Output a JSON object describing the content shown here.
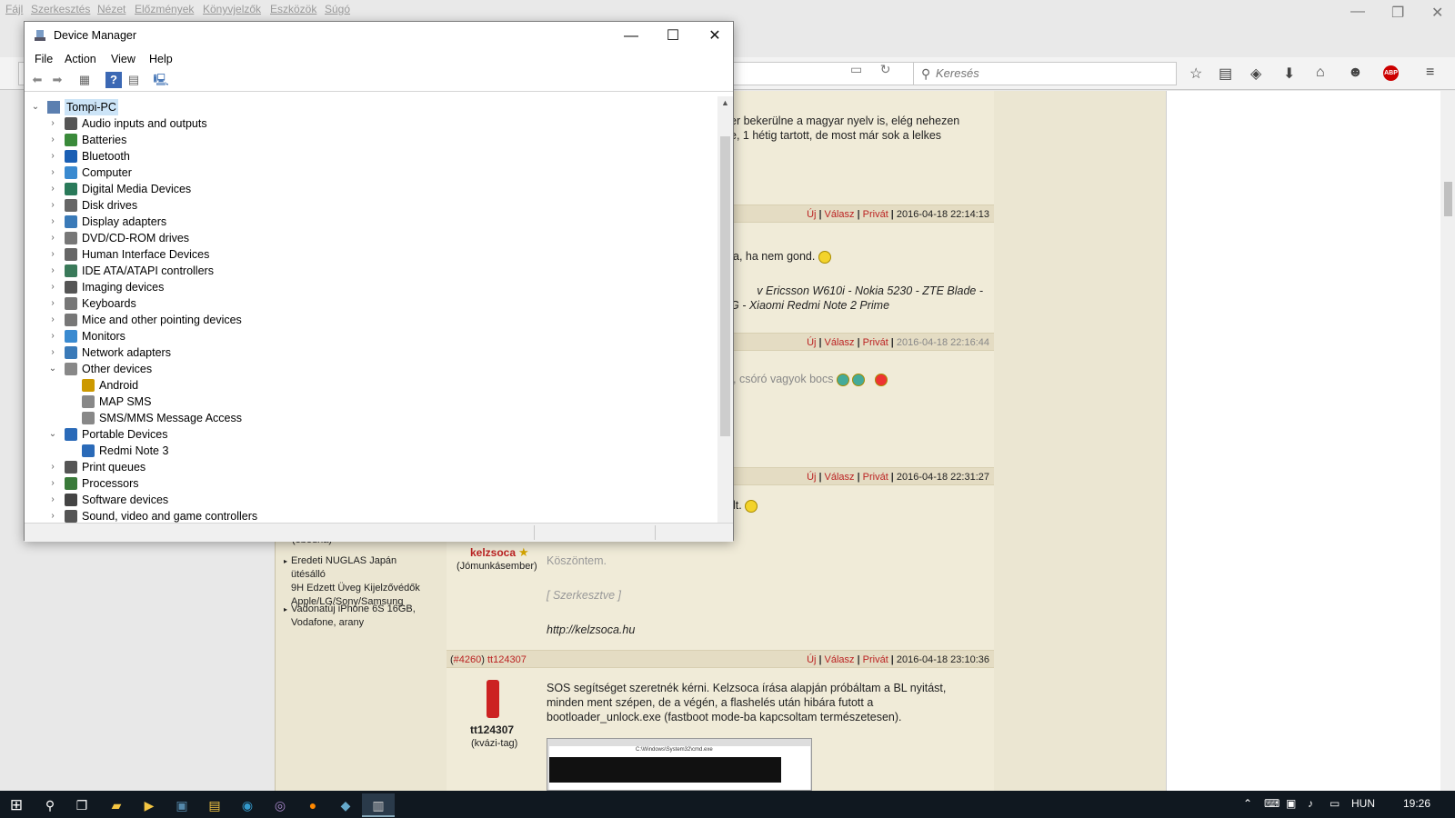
{
  "firefox": {
    "menu": [
      "Fájl",
      "Szerkesztés",
      "Nézet",
      "Előzmények",
      "Könyvjelzők",
      "Eszközök",
      "Súgó"
    ],
    "search_placeholder": "Keresés",
    "window_controls": {
      "minimize": "—",
      "restore": "❐",
      "close": "✕"
    }
  },
  "forum": {
    "post1_text_line1": "er bekerülne a magyar nyelv is, elég nehezen",
    "post1_text_line2": "e, 1 hétig tartott, de most már sok a lelkes",
    "actions": {
      "new": "Új",
      "reply": "Válasz",
      "private": "Privát"
    },
    "post2_date": "2016-04-18 22:14:13",
    "post2_text": "a, ha nem gond.",
    "post2_sig_line1": "v Ericsson W610i - Nokia 5230 - ZTE Blade -",
    "post2_sig_line2": "G - Xiaomi Redmi Note 2 Prime",
    "post3_date": "2016-04-18 22:16:44",
    "post3_text": ", csóró vagyok bocs",
    "post4_date": "2016-04-18 22:31:27",
    "post4_text": "lt.",
    "post4_user": "kelzsoca",
    "post4_rank": "(Jómunkásember)",
    "post4_body_1": "Köszöntem.",
    "post4_body_2": "[ Szerkesztve ]",
    "post4_body_3": "http://kelzsoca.hu",
    "post5_id": "#4260",
    "post5_user_link": "tt124307",
    "post5_date": "2016-04-18 23:10:36",
    "post5_user": "tt124307",
    "post5_rank": "(kvázi-tag)",
    "post5_text_1": "SOS segítséget szeretnék kérni. Kelzsoca írása alapján próbáltam a BL nyitást,",
    "post5_text_2": "minden ment szépen, de a végén, a flashelés után hibára futott a",
    "post5_text_3": "bootloader_unlock.exe (fastboot mode-ba kapcsoltam természetesen).",
    "post5_shot_title": "C:\\Windows\\System32\\cmd.exe",
    "side_partial": "(ebédna)",
    "side_item1_l1": "Eredeti NUGLAS Japán ütésálló",
    "side_item1_l2": "9H Edzett Üveg Kijelzővédők",
    "side_item1_l3": "Apple/LG/Sony/Samsung",
    "side_item2_l1": "Vadonatúj iPhone 6S 16GB,",
    "side_item2_l2": "Vodafone, arany"
  },
  "device_manager": {
    "title": "Device Manager",
    "menu": [
      "File",
      "Action",
      "View",
      "Help"
    ],
    "window_controls": {
      "minimize": "—",
      "maximize": "☐",
      "close": "✕"
    },
    "root": "Tompi-PC",
    "categories": [
      {
        "label": "Audio inputs and outputs",
        "icon": "speaker-icon",
        "color": "#555"
      },
      {
        "label": "Batteries",
        "icon": "battery-icon",
        "color": "#3a8a3a"
      },
      {
        "label": "Bluetooth",
        "icon": "bluetooth-icon",
        "color": "#1a5fb4"
      },
      {
        "label": "Computer",
        "icon": "computer-icon",
        "color": "#3a8ad0"
      },
      {
        "label": "Digital Media Devices",
        "icon": "media-icon",
        "color": "#2a7a5a"
      },
      {
        "label": "Disk drives",
        "icon": "disk-icon",
        "color": "#666"
      },
      {
        "label": "Display adapters",
        "icon": "display-adapter-icon",
        "color": "#3a7ab8"
      },
      {
        "label": "DVD/CD-ROM drives",
        "icon": "dvd-icon",
        "color": "#777"
      },
      {
        "label": "Human Interface Devices",
        "icon": "hid-icon",
        "color": "#666"
      },
      {
        "label": "IDE ATA/ATAPI controllers",
        "icon": "ide-icon",
        "color": "#3a7a5a"
      },
      {
        "label": "Imaging devices",
        "icon": "camera-icon",
        "color": "#555"
      },
      {
        "label": "Keyboards",
        "icon": "keyboard-icon",
        "color": "#777"
      },
      {
        "label": "Mice and other pointing devices",
        "icon": "mouse-icon",
        "color": "#777"
      },
      {
        "label": "Monitors",
        "icon": "monitor-icon",
        "color": "#3a8ad0"
      },
      {
        "label": "Network adapters",
        "icon": "network-icon",
        "color": "#3a7ab8"
      },
      {
        "label": "Other devices",
        "icon": "unknown-device-icon",
        "color": "#888",
        "expanded": true
      },
      {
        "label": "Android",
        "icon": "warning-device-icon",
        "color": "#c90",
        "child": true
      },
      {
        "label": "MAP SMS",
        "icon": "unknown-device-icon",
        "color": "#888",
        "child": true
      },
      {
        "label": "SMS/MMS Message Access",
        "icon": "unknown-device-icon",
        "color": "#888",
        "child": true
      },
      {
        "label": "Portable Devices",
        "icon": "portable-device-icon",
        "color": "#2a6ab8",
        "expanded": true
      },
      {
        "label": "Redmi Note 3",
        "icon": "phone-icon",
        "color": "#2a6ab8",
        "child": true
      },
      {
        "label": "Print queues",
        "icon": "printer-icon",
        "color": "#555"
      },
      {
        "label": "Processors",
        "icon": "processor-icon",
        "color": "#3a7a3a"
      },
      {
        "label": "Software devices",
        "icon": "software-icon",
        "color": "#444"
      },
      {
        "label": "Sound, video and game controllers",
        "icon": "sound-icon",
        "color": "#555"
      }
    ]
  },
  "taskbar": {
    "language": "HUN",
    "time": "19:26",
    "icons": [
      "start-icon",
      "search-icon",
      "task-view-icon",
      "file-explorer-icon",
      "media-player-icon",
      "save-icon",
      "folder-icon",
      "app-icon",
      "browser-icon",
      "firefox-icon",
      "app2-icon",
      "device-manager-icon"
    ]
  }
}
